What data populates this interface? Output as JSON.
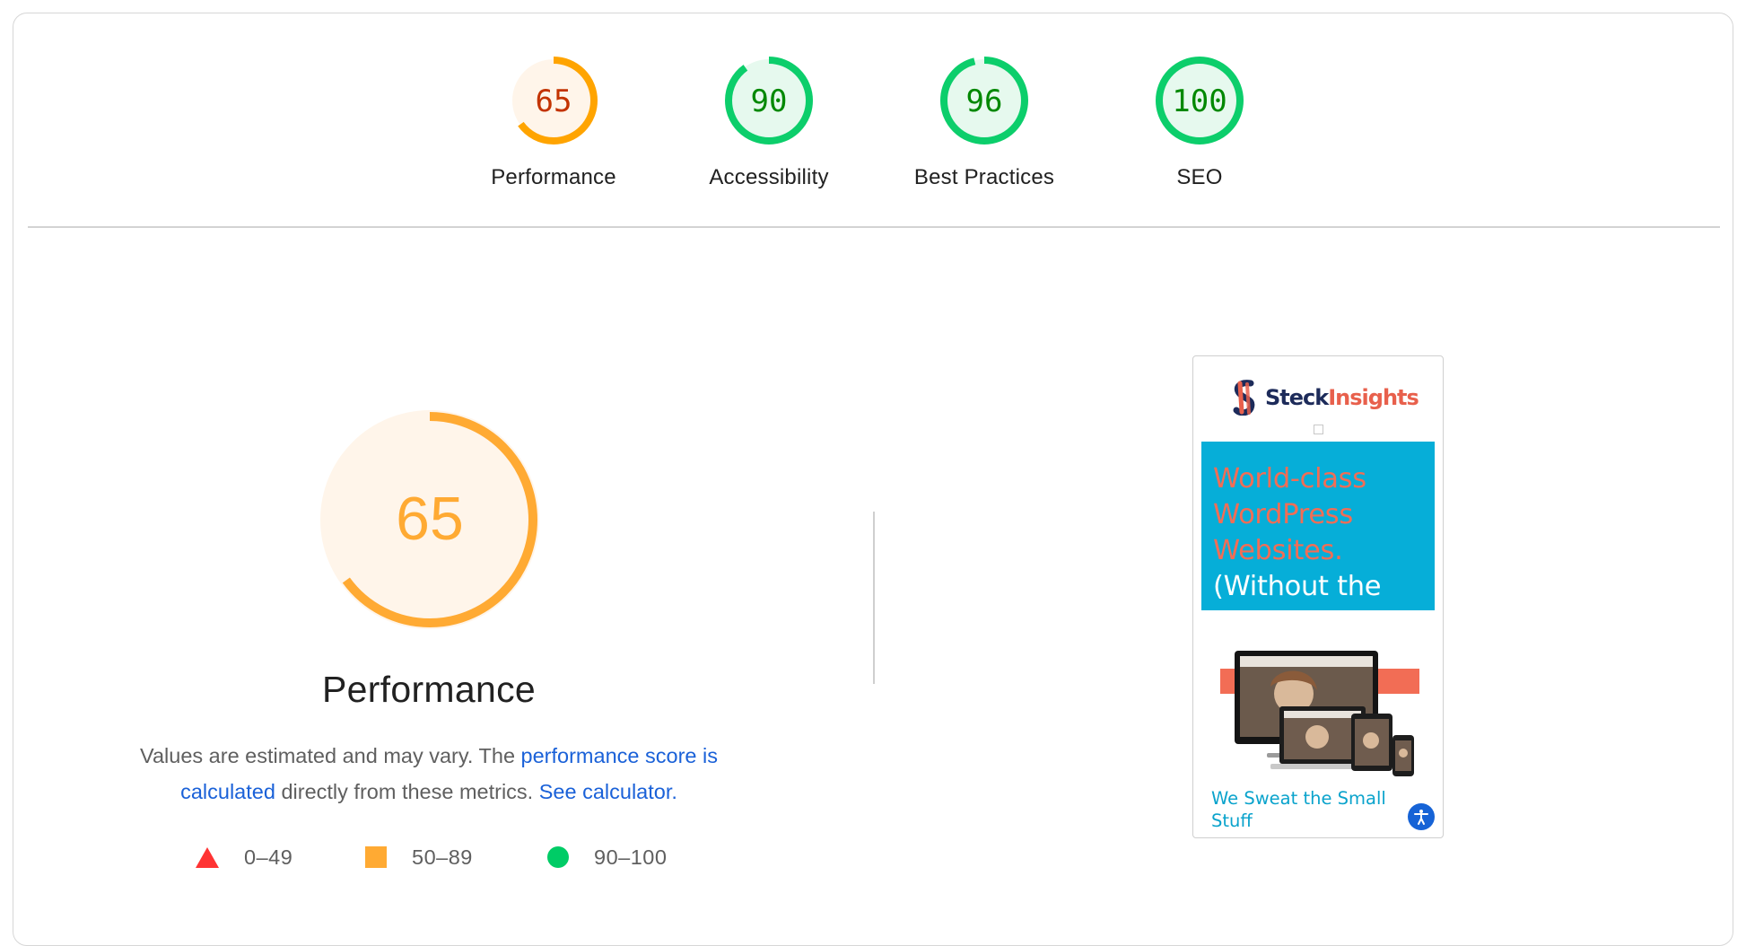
{
  "categories": [
    {
      "label": "Performance",
      "score": 65,
      "status": "average"
    },
    {
      "label": "Accessibility",
      "score": 90,
      "status": "pass"
    },
    {
      "label": "Best Practices",
      "score": 96,
      "status": "pass"
    },
    {
      "label": "SEO",
      "score": 100,
      "status": "pass"
    }
  ],
  "colors": {
    "pass": "#0cce6b",
    "pass_text": "#008800",
    "pass_bg": "#e6f9ee",
    "average": "#ffa400",
    "average_text": "#c33300",
    "average_bg": "#fff5ea",
    "big_average_text": "#fa3",
    "fail": "#ff3333",
    "link": "#1a61d8"
  },
  "performance": {
    "score": 65,
    "title": "Performance",
    "desc_prefix": "Values are estimated and may vary. The ",
    "desc_link1": "performance score is calculated",
    "desc_middle": " directly from these metrics. ",
    "desc_link2": "See calculator.",
    "legend": [
      {
        "icon": "fail-triangle-icon",
        "range": "0–49"
      },
      {
        "icon": "average-square-icon",
        "range": "50–89"
      },
      {
        "icon": "pass-circle-icon",
        "range": "90–100"
      }
    ]
  },
  "screenshot": {
    "logo_part1": "Steck",
    "logo_part2": "Insights",
    "banner_lines_coral": [
      "World-class",
      "WordPress",
      "Websites."
    ],
    "banner_line_white": "(Without the",
    "tagline": "We Sweat the Small Stuff",
    "a11y_icon": "accessibility-icon"
  }
}
